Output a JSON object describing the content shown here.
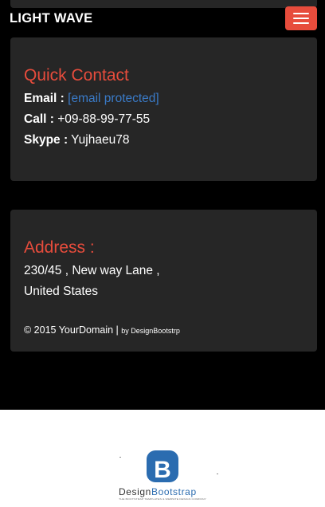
{
  "navbar": {
    "brand": "LIGHT WAVE",
    "toggle_icon": "hamburger-menu-icon"
  },
  "contact": {
    "heading": "Quick Contact",
    "email_label": "Email :",
    "email_value": "[email protected]",
    "call_label": "Call :",
    "call_value": "+09-88-99-77-55",
    "skype_label": "Skype :",
    "skype_value": "Yujhaeu78"
  },
  "address": {
    "heading": "Address :",
    "line1": "230/45 , New way Lane ,",
    "line2": "United States",
    "copyright": "© 2015 YourDomain |",
    "credit": "by DesignBootstrp"
  },
  "footer_logo": {
    "letter": "B",
    "wordmark_part1": "Design",
    "wordmark_part2": "Bootstrap",
    "tagline": "THE BOOTSTRAP TEMPLATES & WEBSITE DESIGN COMPANY"
  },
  "colors": {
    "accent": "#e74c3c",
    "link": "#3a7bc8",
    "panel": "#262626",
    "logo_blue": "#2b6cb0"
  }
}
